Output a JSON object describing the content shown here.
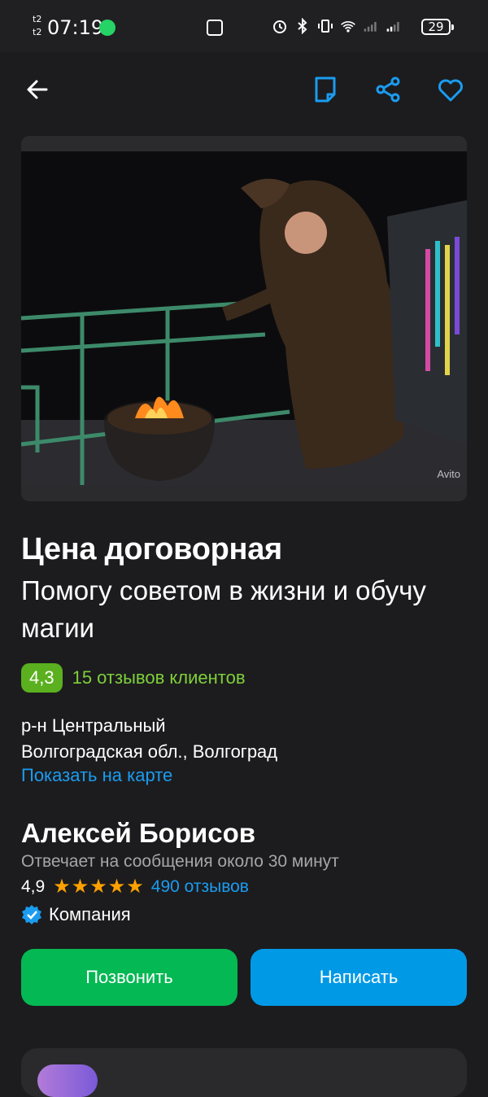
{
  "status_bar": {
    "carrier_top": "t2",
    "carrier_bottom": "t2",
    "time": "07:19",
    "battery": "29"
  },
  "toolbar": {
    "back_icon": "arrow-left-icon",
    "note_icon": "note-icon",
    "share_icon": "share-icon",
    "favorite_icon": "heart-icon"
  },
  "listing": {
    "photo_watermark": "Avito",
    "price": "Цена договорная",
    "title": "Помогу советом в жизни и обучу магии",
    "rating": "4,3",
    "reviews_text": "15 отзывов клиентов",
    "address_line1": "р-н Центральный",
    "address_line2": "Волгоградская обл., Волгоград",
    "map_link": "Показать на карте"
  },
  "seller": {
    "name": "Алексей Борисов",
    "response_time": "Отвечает на сообщения около 30 минут",
    "rating": "4,9",
    "stars": "★★★★★",
    "star_value": 5,
    "reviews": "490 отзывов",
    "type": "Компания"
  },
  "actions": {
    "call": "Позвонить",
    "write": "Написать"
  },
  "colors": {
    "background": "#1c1c1e",
    "accent_blue": "#1a9cf0",
    "call_green": "#04b853",
    "write_blue": "#0099e6",
    "rating_green": "#5ab01e",
    "star_orange": "#ffa100"
  }
}
